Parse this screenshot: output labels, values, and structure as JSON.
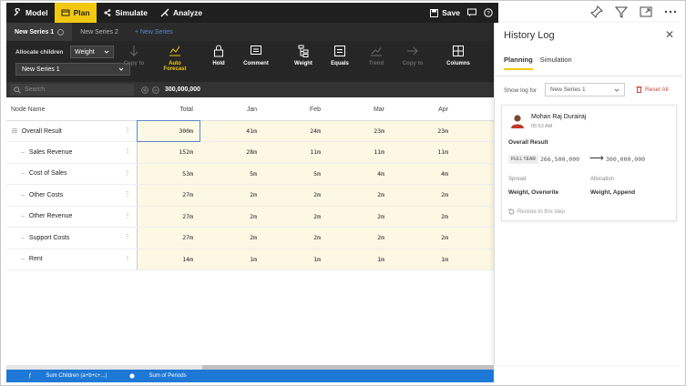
{
  "topbar": {
    "items": [
      {
        "label": "Model",
        "icon": "wrench-icon"
      },
      {
        "label": "Plan",
        "icon": "plan-icon"
      },
      {
        "label": "Simulate",
        "icon": "simulate-icon"
      },
      {
        "label": "Analyze",
        "icon": "analyze-icon"
      }
    ],
    "save_label": "Save"
  },
  "series_tabs": {
    "active": "New Series 1",
    "second": "New Series 2",
    "new": "+ New Series"
  },
  "ribbon": {
    "allocate_label": "Allocate children",
    "allocate_value": "Weight",
    "series_value": "New Series 1",
    "buttons": [
      {
        "label": "Copy to"
      },
      {
        "label": "Auto Forecast"
      },
      {
        "label": "Hold"
      },
      {
        "label": "Comment"
      },
      {
        "label": "Weight"
      },
      {
        "label": "Equals"
      },
      {
        "label": "Trend"
      },
      {
        "label": "Copy to"
      },
      {
        "label": "Columns"
      }
    ]
  },
  "search": {
    "placeholder": "Search",
    "value": "300,000,000"
  },
  "grid": {
    "headers": [
      "Node Name",
      "Total",
      "Jan",
      "Feb",
      "Mar",
      "Apr",
      ""
    ],
    "rows": [
      {
        "name": "Overall Result",
        "values": [
          "300m",
          "41m",
          "24m",
          "23m",
          "23m",
          ""
        ]
      },
      {
        "name": "Sales Revenue",
        "values": [
          "152m",
          "28m",
          "11m",
          "11m",
          "11m",
          ""
        ]
      },
      {
        "name": "Cost of Sales",
        "values": [
          "53m",
          "5m",
          "5m",
          "4m",
          "4m",
          ""
        ]
      },
      {
        "name": "Other Costs",
        "values": [
          "27m",
          "2m",
          "2m",
          "2m",
          "2m",
          ""
        ]
      },
      {
        "name": "Other Revenue",
        "values": [
          "27m",
          "2m",
          "2m",
          "2m",
          "2m",
          ""
        ]
      },
      {
        "name": "Support Costs",
        "values": [
          "27m",
          "2m",
          "2m",
          "2m",
          "2m",
          ""
        ]
      },
      {
        "name": "Rent",
        "values": [
          "14m",
          "1m",
          "1m",
          "1m",
          "1m",
          ""
        ]
      }
    ]
  },
  "statusbar": {
    "sum_children": "Sum Children (a+b+c+...)",
    "sum_periods": "Sum of Periods"
  },
  "history": {
    "title": "History Log",
    "tabs": [
      "Planning",
      "Simulation"
    ],
    "show_log_label": "Show log for",
    "show_log_value": "New Series 1",
    "reset_label": "Reset All",
    "entry": {
      "user": "Mohan Raj Durairaj",
      "time": "05:53 AM",
      "node": "Overall Result",
      "period": "FULL YEAR",
      "from": "266,500,000",
      "to": "300,000,000",
      "spread_label": "Spread",
      "spread_value": "Weight, Overwrite",
      "allocation_label": "Allocation",
      "allocation_value": "Weight, Append",
      "restore_label": "Restore to this step"
    }
  },
  "colors": {
    "accent": "#f2c811",
    "dark": "#1f1f1f",
    "status_blue": "#1e78d6",
    "cell_bg": "#fcf8e4",
    "reset_red": "#c84a3a"
  }
}
